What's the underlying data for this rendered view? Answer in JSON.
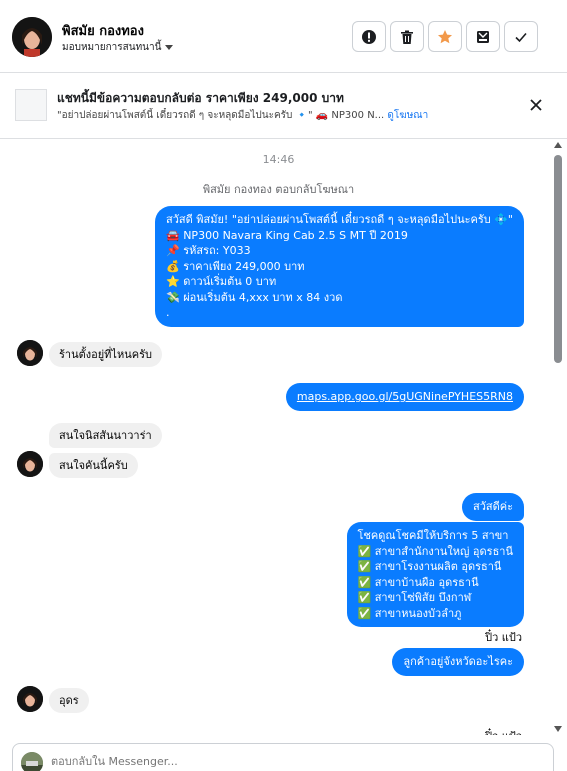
{
  "header": {
    "contact_name": "พิสมัย กองทอง",
    "assign_label": "มอบหมายการสนทนานี้",
    "actions": [
      {
        "name": "report-button",
        "icon": "alert-icon"
      },
      {
        "name": "delete-button",
        "icon": "trash-icon"
      },
      {
        "name": "star-button",
        "icon": "star-icon"
      },
      {
        "name": "archive-button",
        "icon": "archive-icon"
      },
      {
        "name": "mark-done-button",
        "icon": "check-icon"
      }
    ]
  },
  "ad_bar": {
    "title": "แชทนี้มีข้อความตอบกลับต่อ ราคาเพียง 249,000 บาท",
    "subtitle": "\"อย่าปล่อยผ่านโพสต์นี้ เดี๋ยวรถดี ๆ จะหลุดมือไปนะครับ 🔹\" 🚗 NP300 N...",
    "link": "ดูโฆษณา"
  },
  "chat": {
    "time": "14:46",
    "reply_note": "พิสมัย กองทอง ตอบกลับโฆษณา",
    "ad_message": [
      "สวัสดี พิสมัย! \"อย่าปล่อยผ่านโพสต์นี้ เดี๋ยวรถดี ๆ จะหลุดมือไปนะครับ 💠\"",
      "🚘 NP300 Navara King Cab 2.5 S MT ปี 2019",
      "📌 รหัสรถ: Y033",
      "💰 ราคาเพียง 249,000 บาท",
      "⭐ ดาวน์เริ่มต้น 0 บาท",
      "💸 ผ่อนเริ่มต้น 4,xxx บาท x 84 งวด",
      "."
    ],
    "msg_where": "ร้านตั้งอยู่ที่ไหนครับ",
    "msg_maps": "maps.app.goo.gl/5gUGNinePYHES5RN8",
    "msg_finance": "สนใจนิสสันนาวาร่า",
    "msg_interest": "สนใจคันนี้ครับ",
    "msg_hello": "สวัสดีค่ะ",
    "branches": [
      "โชคดูณโชคมีให้บริการ 5 สาขา",
      "✅ สาขาสำนักงานใหญ่ อุดรธานี",
      "✅ สาขาโรงงานผลิต อุดรธานี",
      "✅ สาขาบ้านผือ อุดรธานี",
      "✅ สาขาโซ่พิสัย บึงกาฬ",
      "✅ สาขาหนองบัวลำภู"
    ],
    "seen_1": "ปิ๋ว แป้ว",
    "msg_province": "ลูกค้าอยู่จังหวัดอะไรคะ",
    "msg_udon": "อุดร",
    "seen_2": "ปิ๋ว แป้ว"
  },
  "composer": {
    "placeholder": "ตอบกลับใน Messenger..."
  },
  "colors": {
    "bubble_out": "#0a7cff",
    "bubble_in": "#f0f0f0",
    "star": "#f2994a",
    "link": "#1877f2"
  }
}
